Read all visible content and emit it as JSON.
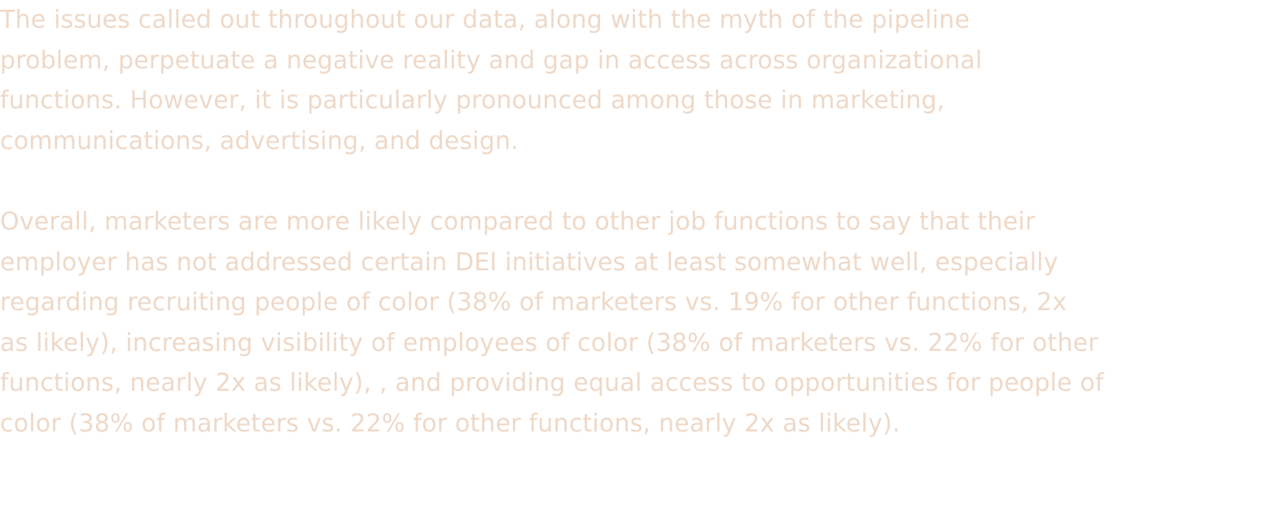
{
  "colors": {
    "text": "#eed9c8",
    "background": "#ffffff"
  },
  "paragraphs": [
    {
      "lines": [
        "The issues called out throughout our data, along with the myth of the pipeline",
        "problem, perpetuate a negative reality and gap in access across organizational",
        "functions. However, it is particularly pronounced among those in marketing,",
        "communications, advertising, and design."
      ]
    },
    {
      "lines": [
        "Overall, marketers are more likely compared to other job functions to say that their",
        "employer has not addressed certain DEI initiatives at least somewhat well, especially",
        "regarding recruiting people of color (38% of marketers vs. 19% for other functions, 2x",
        "as likely), increasing visibility of employees of color (38% of marketers vs. 22% for other",
        "functions, nearly 2x as likely), , and providing equal access to opportunities for people of",
        "color (38% of marketers vs. 22% for other functions, nearly 2x as likely)."
      ]
    }
  ]
}
